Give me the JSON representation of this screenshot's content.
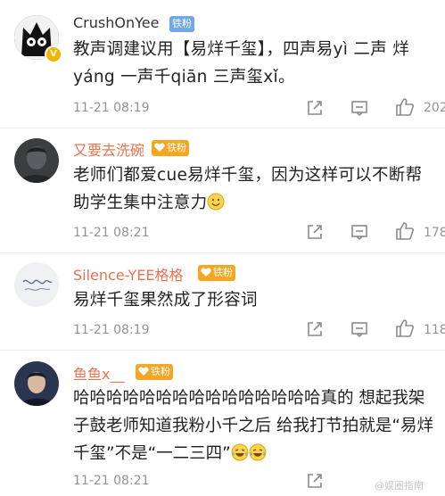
{
  "comments": [
    {
      "username": "CrushOnYee",
      "badge": "铁粉",
      "text": "教声调建议用【易烊千玺】，四声易yì 二声 烊yáng 一声千qiān 三声玺xǐ。",
      "time": "11-21 08:19",
      "likes": "202"
    },
    {
      "username": "又要去洗碗",
      "badge": "铁粉",
      "text": "老师们都爱cue易烊千玺，因为这样可以不断帮助学生集中注意力",
      "time": "11-21 08:21",
      "likes": "178"
    },
    {
      "username": "Silence-YEE格格",
      "badge": "铁粉",
      "text": "易烊千玺果然成了形容词",
      "time": "11-21 08:19",
      "likes": "118"
    },
    {
      "username": "鱼鱼x__",
      "badge": "铁粉",
      "text": "哈哈哈哈哈哈哈哈哈哈哈哈哈哈哈真的 想起我架子鼓老师知道我粉小千之后 给我打节拍就是“易烊千玺”不是“一二三四”",
      "time": "11-21 08:21",
      "likes": ""
    }
  ],
  "watermark": "@娱圈指南",
  "icons": {
    "share": "share-icon",
    "comment": "comment-icon",
    "like": "thumbs-up-icon",
    "emoji_smile": "smile-emoji",
    "emoji_cry": "laugh-cry-emoji"
  },
  "colors": {
    "username_orange": "#eb7350",
    "username_gray": "#333333",
    "fan_badge_blue": "#6fa7e8",
    "fan_badge_gold": "#f5a623",
    "meta_gray": "#939393"
  }
}
